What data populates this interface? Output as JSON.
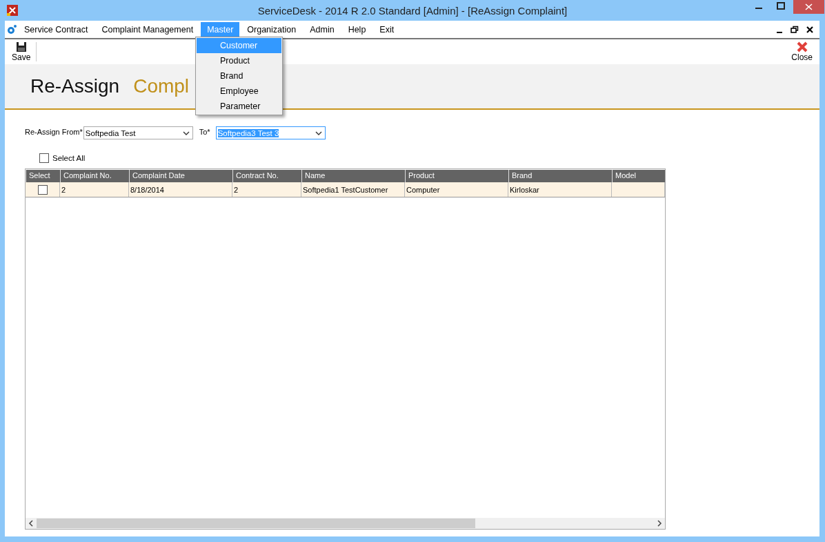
{
  "window": {
    "title": "ServiceDesk - 2014 R 2.0 Standard [Admin] - [ReAssign Complaint]"
  },
  "menu_bar": [
    {
      "label": "Service Contract",
      "selected": false
    },
    {
      "label": "Complaint Management",
      "selected": false
    },
    {
      "label": "Master",
      "selected": true
    },
    {
      "label": "Organization",
      "selected": false
    },
    {
      "label": "Admin",
      "selected": false
    },
    {
      "label": "Help",
      "selected": false
    },
    {
      "label": "Exit",
      "selected": false
    }
  ],
  "master_menu": [
    {
      "label": "Customer",
      "selected": true
    },
    {
      "label": "Product",
      "selected": false
    },
    {
      "label": "Brand",
      "selected": false
    },
    {
      "label": "Employee",
      "selected": false
    },
    {
      "label": "Parameter",
      "selected": false
    }
  ],
  "toolbar": {
    "save": "Save",
    "close": "Close"
  },
  "header": {
    "title": "Re-Assign",
    "subtitle": "Compl"
  },
  "form": {
    "from_label": "Re-Assign From*",
    "from_value": "Softpedia Test",
    "to_label": "To*",
    "to_value": "Softpedia3 Test 3",
    "select_all": {
      "label": "Select All",
      "checked": false
    }
  },
  "table": {
    "columns": [
      "Select",
      "Complaint No.",
      "Complaint Date",
      "Contract No.",
      "Name",
      "Product",
      "Brand",
      "Model"
    ],
    "rows": [
      {
        "checked": false,
        "cells": [
          "",
          "2",
          "8/18/2014",
          "2",
          "Softpedia1 TestCustomer",
          "Computer",
          "Kirloskar",
          ""
        ]
      }
    ]
  }
}
